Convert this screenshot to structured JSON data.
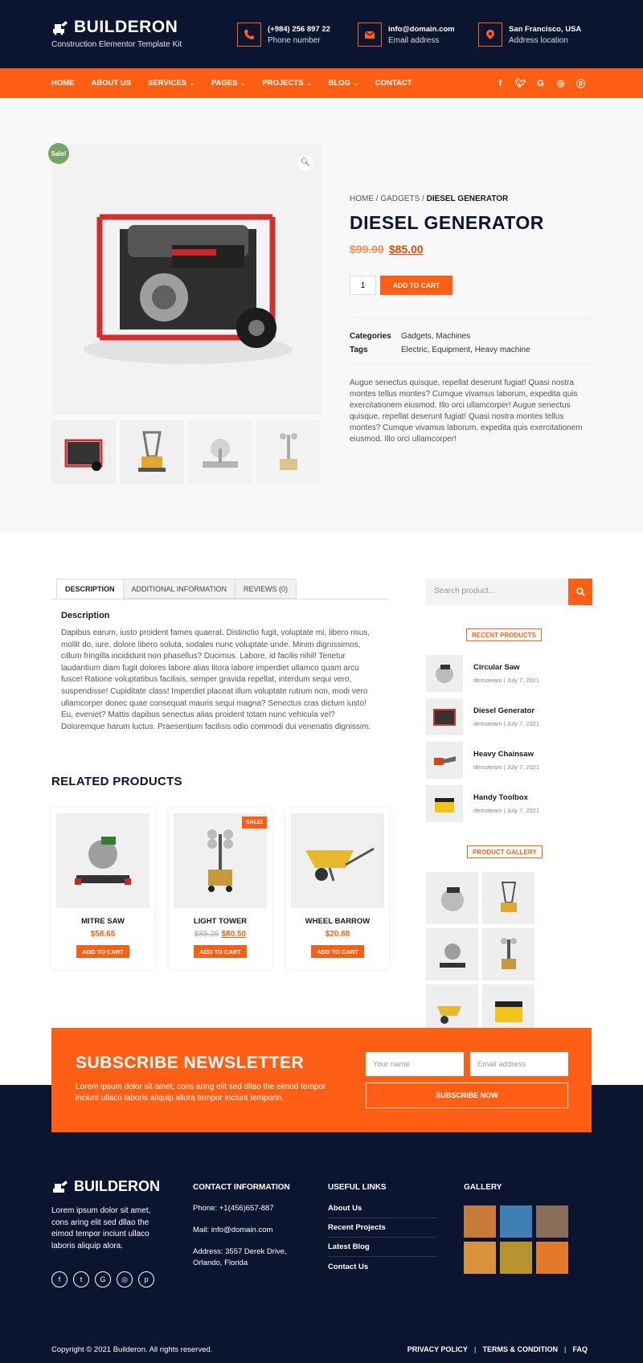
{
  "brand": {
    "name": "BUILDERON",
    "tagline": "Construction Elementor Template Kit"
  },
  "header_contacts": [
    {
      "icon": "phone-icon",
      "value": "(+984) 256 897 22",
      "label": "Phone number"
    },
    {
      "icon": "mail-icon",
      "value": "info@domain.com",
      "label": "Email address"
    },
    {
      "icon": "location-pin-icon",
      "value": "San Francisco, USA",
      "label": "Address location"
    }
  ],
  "nav": {
    "items": [
      "HOME",
      "ABOUT US",
      "SERVICES",
      "PAGES",
      "PROJECTS",
      "BLOG",
      "CONTACT"
    ]
  },
  "social": [
    "facebook-icon",
    "twitter-icon",
    "google-icon",
    "instagram-icon",
    "pinterest-icon"
  ],
  "product": {
    "sale_badge": "Sale!",
    "breadcrumb": {
      "home": "HOME",
      "sep": "/",
      "gadgets": "GADGETS",
      "current": "DIESEL GENERATOR"
    },
    "title": "DIESEL GENERATOR",
    "old_price": "$99.00",
    "price": "$85.00",
    "qty": "1",
    "add_to_cart": "ADD TO CART",
    "categories_label": "Categories",
    "categories": "Gadgets, Machines",
    "tags_label": "Tags",
    "tags": "Electric, Equipment, Heavy machine",
    "description": "Augue senectus quisque, repellat deserunt fugiat! Quasi nostra montes tellus montes? Cumque vivamus laborum, expedita quis exercitationem eiusmod. Illo orci ullamcorper! Augue senectus quisque, repellat deserunt fugiat! Quasi nostra montes tellus montes? Cumque vivamus laborum, expedita quis exercitationem eiusmod. Illo orci ullamcorper!"
  },
  "tabs": [
    "DESCRIPTION",
    "ADDITIONAL INFORMATION",
    "REVIEWS (0)"
  ],
  "description": {
    "title": "Description",
    "text": "Dapibus earum, iusto proident fames quaerat. Distinctio fugit, voluptate mi, libero risus, mollit do, iure, dolore libero soluta, sodales nunc voluptate unde. Minim dignissimos, cillum fringilla incididunt non phasellus? Ducimus. Labore, id facilis nihil! Tenetur laudantium diam fugit dolores labore alias litora labore imperdiet ullamco quam arcu fusce! Ratione voluptatibus facilisis, semper gravida repellat, interdum sequi vero, suspendisse! Cupiditate class! Imperdiet placeat illum voluptate rutrum non, modi vero ullamcorper donec quae consequat mauris sequi magna? Senectus cras dictum iusto! Eu, eveniet? Mattis dapibus senectus alias proident totam nunc vehicula vel? Doloremque harum luctus. Praesentium facilisis odio commodi dui venenatis dignissim."
  },
  "related": {
    "title": "RELATED PRODUCTS",
    "items": [
      {
        "name": "MITRE SAW",
        "old": "",
        "price": "$58.65",
        "sale": "",
        "btn": "ADD TO CART"
      },
      {
        "name": "LIGHT TOWER",
        "old": "$85.25",
        "price": "$80.50",
        "sale": "SALE!",
        "btn": "ADD TO CART"
      },
      {
        "name": "WHEEL BARROW",
        "old": "",
        "price": "$20.88",
        "sale": "",
        "btn": "ADD TO CART"
      }
    ]
  },
  "sidebar": {
    "search_placeholder": "Search product...",
    "recent_title": "RECENT PRODUCTS",
    "recent": [
      {
        "name": "Circular Saw",
        "meta": "demoteam | July 7, 2021"
      },
      {
        "name": "Diesel Generator",
        "meta": "demoteam | July 7, 2021"
      },
      {
        "name": "Heavy Chainsaw",
        "meta": "demoteam | July 7, 2021"
      },
      {
        "name": "Handy Toolbox",
        "meta": "demoteam | July 7, 2021"
      }
    ],
    "gallery_title": "PRODUCT GALLERY"
  },
  "newsletter": {
    "title": "SUBSCRIBE NEWSLETTER",
    "text": "Lorem ipsum dolor sit amet, cons aring elit sed dllao the eimod tempor inciunt ullaco laboris aliquip aliora tempor inciunt temporin.",
    "name_placeholder": "Your name",
    "email_placeholder": "Email address",
    "button": "SUBSCRIBE NOW"
  },
  "footer": {
    "about": "Lorem ipsum dolor sit amet, cons aring elit sed dllao the eimod tempor inciunt ullaco laboris aliquip alora.",
    "contact_title": "CONTACT INFORMATION",
    "phone": "Phone: +1(456)657-887",
    "mail": "Mail: info@domain.com",
    "address": "Address: 3557 Derek Drive, Orlando, Florida",
    "links_title": "USEFUL LINKS",
    "links": [
      "About Us",
      "Recent Projects",
      "Latest Blog",
      "Contact Us"
    ],
    "gallery_title": "GALLERY",
    "copyright": "Copyright © 2021 Builderon. All rights reserved.",
    "menu": [
      "PRIVACY POLICY",
      "TERMS & CONDITION",
      "FAQ"
    ]
  },
  "colors": {
    "accent": "#ff5f14",
    "dark": "#0b1530",
    "sale_green": "#77a464"
  }
}
